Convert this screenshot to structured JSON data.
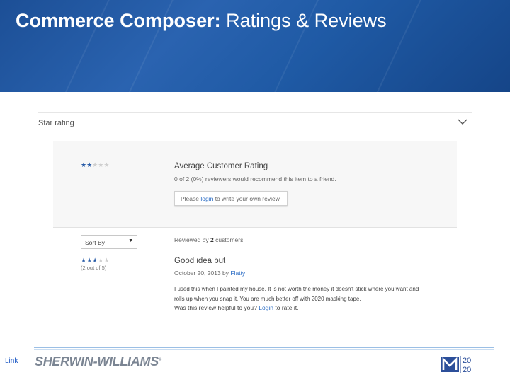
{
  "header": {
    "title_bold": "Commerce Composer:",
    "title_rest": " Ratings & Reviews"
  },
  "section": {
    "title": "Star rating",
    "toggle_icon": "chevron-down-icon"
  },
  "summary": {
    "rating_fraction": 0.4,
    "star_count": 5,
    "filled_stars": 2,
    "heading": "Average Customer Rating",
    "recommend_text": "0 of 2 (0%) reviewers would recommend this item to a friend.",
    "login_prefix": "Please ",
    "login_link": "login",
    "login_suffix": " to write your own review."
  },
  "sort": {
    "selected": "Sort By",
    "arrow_icon": "triangle-down-icon"
  },
  "reviews_meta": {
    "prefix": "Reviewed by ",
    "count": "2",
    "suffix": " customers"
  },
  "review": {
    "star_count": 5,
    "filled_stars": 2.5,
    "stars_caption": "(2 out of 5)",
    "title": "Good idea but",
    "date_prefix": "October 20, 2013 by ",
    "author": "Flatty",
    "body_line1": "I used this when I painted my house. It is not worth the money it doesn't stick where you want and",
    "body_line2": "rolls up when you snap it. You are much better off with 2020 masking tape.",
    "helpful_prefix": "Was this review helpful to you? ",
    "helpful_link": "Login",
    "helpful_suffix": " to rate it."
  },
  "footer": {
    "link_label": "Link",
    "brand_logo_text": "SHERWIN-WILLIAMS",
    "brand_reg": "®",
    "partner_logo_text": "M 20 20",
    "colors": {
      "header_blue": "#1f5aa5",
      "link_blue": "#2a6cc4",
      "star_blue": "#2a5da8"
    }
  }
}
